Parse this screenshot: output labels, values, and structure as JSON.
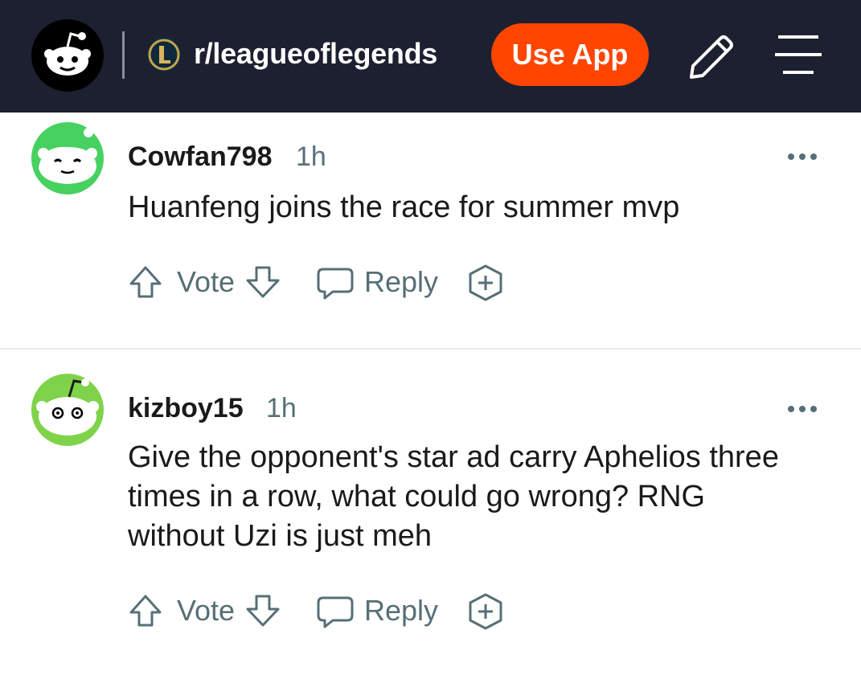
{
  "header": {
    "subreddit": "r/leagueoflegends",
    "use_app_label": "Use App",
    "icons": [
      "reddit-logo-icon",
      "subreddit-icon",
      "pencil-icon",
      "menu-icon"
    ],
    "colors": {
      "bar": "#1c2030",
      "accent": "#ff4500"
    }
  },
  "comments": [
    {
      "author": "Cowfan798",
      "time": "1h",
      "body": "Huanfeng joins the race for summer mvp",
      "vote_label": "Vote",
      "reply_label": "Reply"
    },
    {
      "author": "kizboy15",
      "time": "1h",
      "body": "Give the opponent's star ad carry Aphelios three times in a row, what could go wrong? RNG without Uzi is just meh",
      "vote_label": "Vote",
      "reply_label": "Reply"
    }
  ]
}
